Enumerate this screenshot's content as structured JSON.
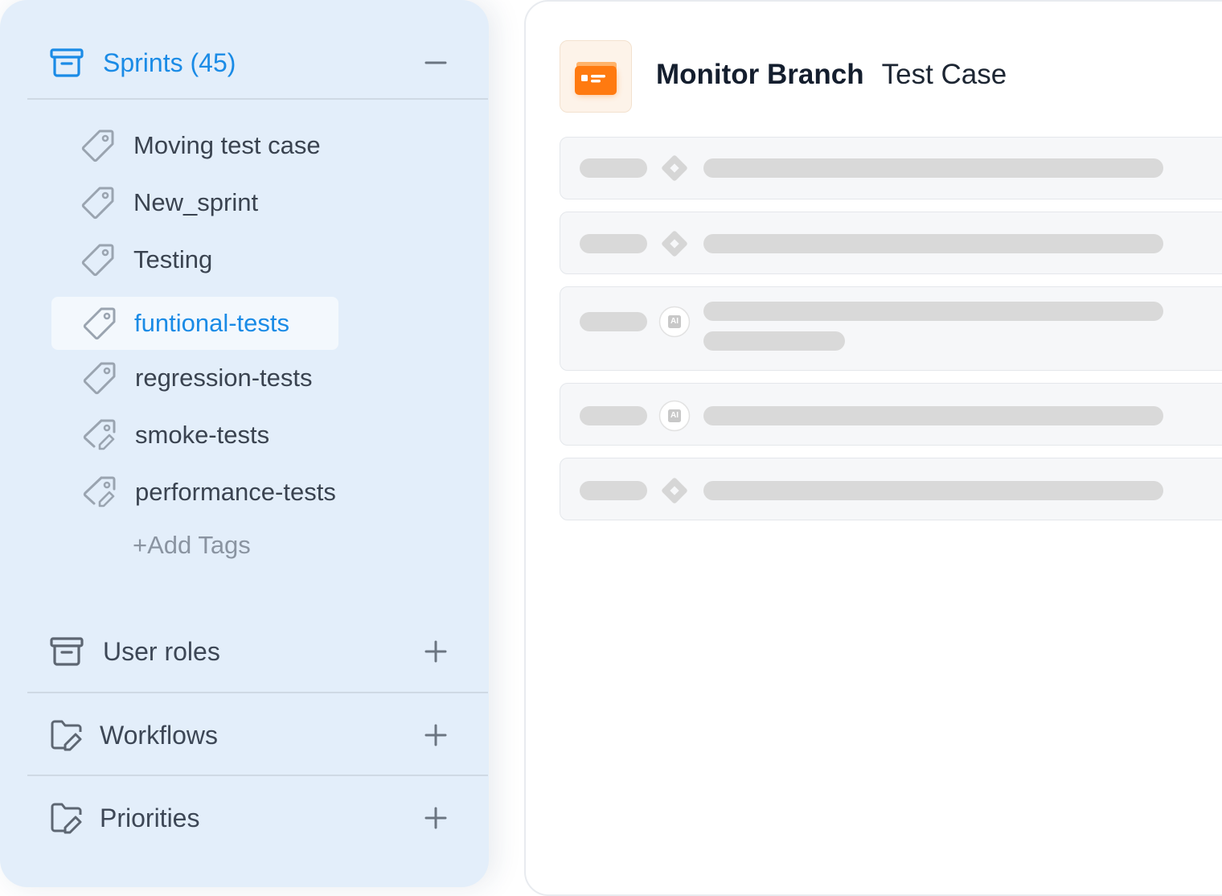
{
  "sidebar": {
    "sprints": {
      "label": "Sprints (45)",
      "icon": "archive-box-icon",
      "toggle": "minus-icon",
      "expanded": true
    },
    "tags": [
      {
        "label": "Moving test case",
        "icon": "tag-icon"
      },
      {
        "label": "New_sprint",
        "icon": "tag-icon"
      },
      {
        "label": "Testing",
        "icon": "tag-icon"
      },
      {
        "label": "funtional-tests",
        "icon": "tag-icon",
        "selected": true
      },
      {
        "label": "regression-tests",
        "icon": "tag-icon"
      },
      {
        "label": "smoke-tests",
        "icon": "tag-edit-icon"
      },
      {
        "label": "performance-tests",
        "icon": "tag-edit-icon"
      }
    ],
    "add_tags": "+Add Tags",
    "user_roles": {
      "label": "User roles",
      "icon": "archive-box-icon",
      "toggle": "plus-icon"
    },
    "workflows": {
      "label": "Workflows",
      "icon": "folder-edit-icon",
      "toggle": "plus-icon"
    },
    "priorities": {
      "label": "Priorities",
      "icon": "folder-edit-icon",
      "toggle": "plus-icon"
    }
  },
  "main": {
    "app_icon": "branch-folder-icon",
    "title": "Monitor Branch",
    "subtitle": "Test Case",
    "rows": [
      {
        "badge": "diamond-icon"
      },
      {
        "badge": "diamond-icon"
      },
      {
        "badge": "ai-badge-icon",
        "badge_text": "AI",
        "two_lines": true
      },
      {
        "badge": "ai-badge-icon",
        "badge_text": "AI"
      },
      {
        "badge": "diamond-icon"
      }
    ]
  },
  "colors": {
    "accent": "#1a8be6",
    "sidebar_bg": "#e3eefa",
    "icon_orange": "#ff7a10"
  }
}
